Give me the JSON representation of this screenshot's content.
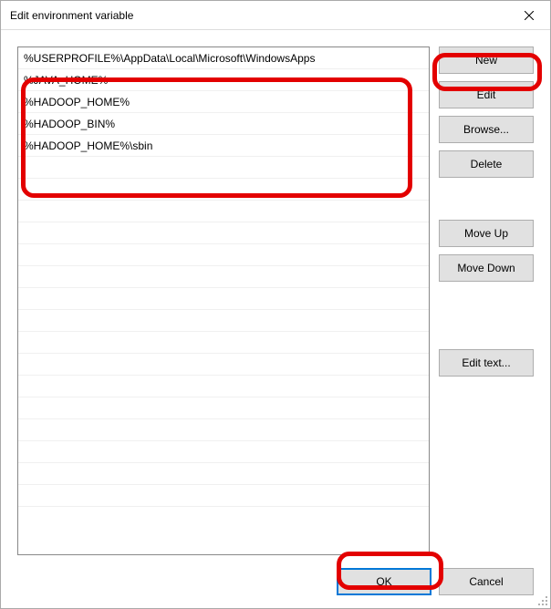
{
  "window": {
    "title": "Edit environment variable"
  },
  "list": {
    "items": [
      "%USERPROFILE%\\AppData\\Local\\Microsoft\\WindowsApps",
      "%JAVA_HOME%",
      "%HADOOP_HOME%",
      "%HADOOP_BIN%",
      "%HADOOP_HOME%\\sbin"
    ]
  },
  "buttons": {
    "new": "New",
    "edit": "Edit",
    "browse": "Browse...",
    "delete": "Delete",
    "moveUp": "Move Up",
    "moveDown": "Move Down",
    "editText": "Edit text...",
    "ok": "OK",
    "cancel": "Cancel"
  }
}
